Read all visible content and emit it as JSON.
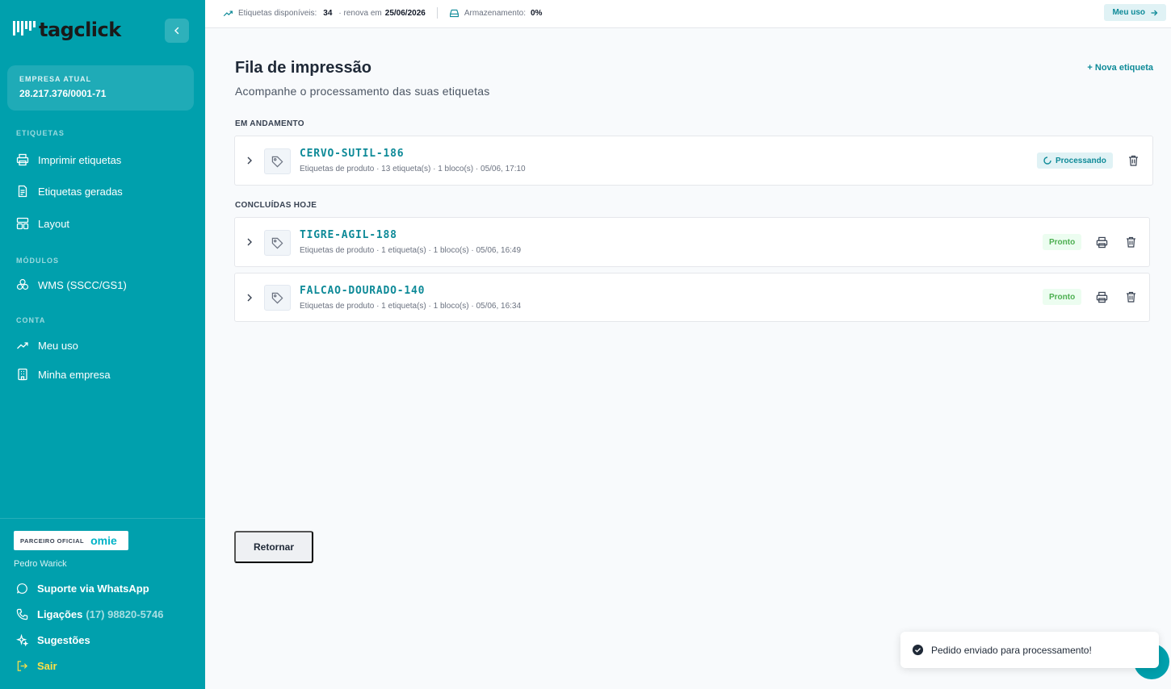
{
  "sidebar": {
    "logo_text": "tagclick",
    "company": {
      "label": "EMPRESA ATUAL",
      "value": "28.217.376/0001-71"
    },
    "sections": {
      "etiquetas": "ETIQUETAS",
      "modulos": "MÓDULOS",
      "conta": "CONTA"
    },
    "items": [
      {
        "label": "Imprimir etiquetas",
        "icon": "printer-icon"
      },
      {
        "label": "Etiquetas geradas",
        "icon": "file-icon"
      },
      {
        "label": "Layout",
        "icon": "layout-icon"
      },
      {
        "label": "WMS (SSCC/GS1)",
        "icon": "boxes-icon"
      },
      {
        "label": "Meu uso",
        "icon": "trending-up-icon"
      },
      {
        "label": "Minha empresa",
        "icon": "building-icon"
      }
    ],
    "footer": {
      "partner_text": "PARCEIRO OFICIAL",
      "partner_brand": "omie",
      "user_name": "Pedro Warick",
      "support": "Suporte via WhatsApp",
      "calls_label": "Ligações",
      "calls_number": "(17) 98820-5746",
      "suggestions": "Sugestões",
      "exit": "Sair"
    }
  },
  "topbar": {
    "labels_available_label": "Etiquetas disponíveis:",
    "labels_available_value": "34",
    "renews_label": "· renova em",
    "renews_date": "25/06/2026",
    "storage_label": "Armazenamento:",
    "storage_value": "0%",
    "usage_button": "Meu uso"
  },
  "main": {
    "title": "Fila de impressão",
    "subtitle": "Acompanhe o processamento das suas etiquetas",
    "new_label": "+ Nova etiqueta",
    "in_progress_label": "EM ANDAMENTO",
    "completed_label": "CONCLUÍDAS HOJE",
    "in_progress": [
      {
        "name": "CERVO-SUTIL-186",
        "meta": "Etiquetas de produto · 13 etiqueta(s) · 1 bloco(s) · 05/06, 17:10",
        "status": "Processando"
      }
    ],
    "completed": [
      {
        "name": "TIGRE-AGIL-188",
        "meta": "Etiquetas de produto · 1 etiqueta(s) · 1 bloco(s) · 05/06, 16:49",
        "status": "Pronto"
      },
      {
        "name": "FALCAO-DOURADO-140",
        "meta": "Etiquetas de produto · 1 etiqueta(s) · 1 bloco(s) · 05/06, 16:34",
        "status": "Pronto"
      }
    ],
    "return_button": "Retornar"
  },
  "toast": {
    "message": "Pedido enviado para processamento!"
  },
  "colors": {
    "brand": "#00a0ad",
    "accent_text": "#0e8a98",
    "ready": "#4caf50",
    "exit": "#fde047"
  }
}
